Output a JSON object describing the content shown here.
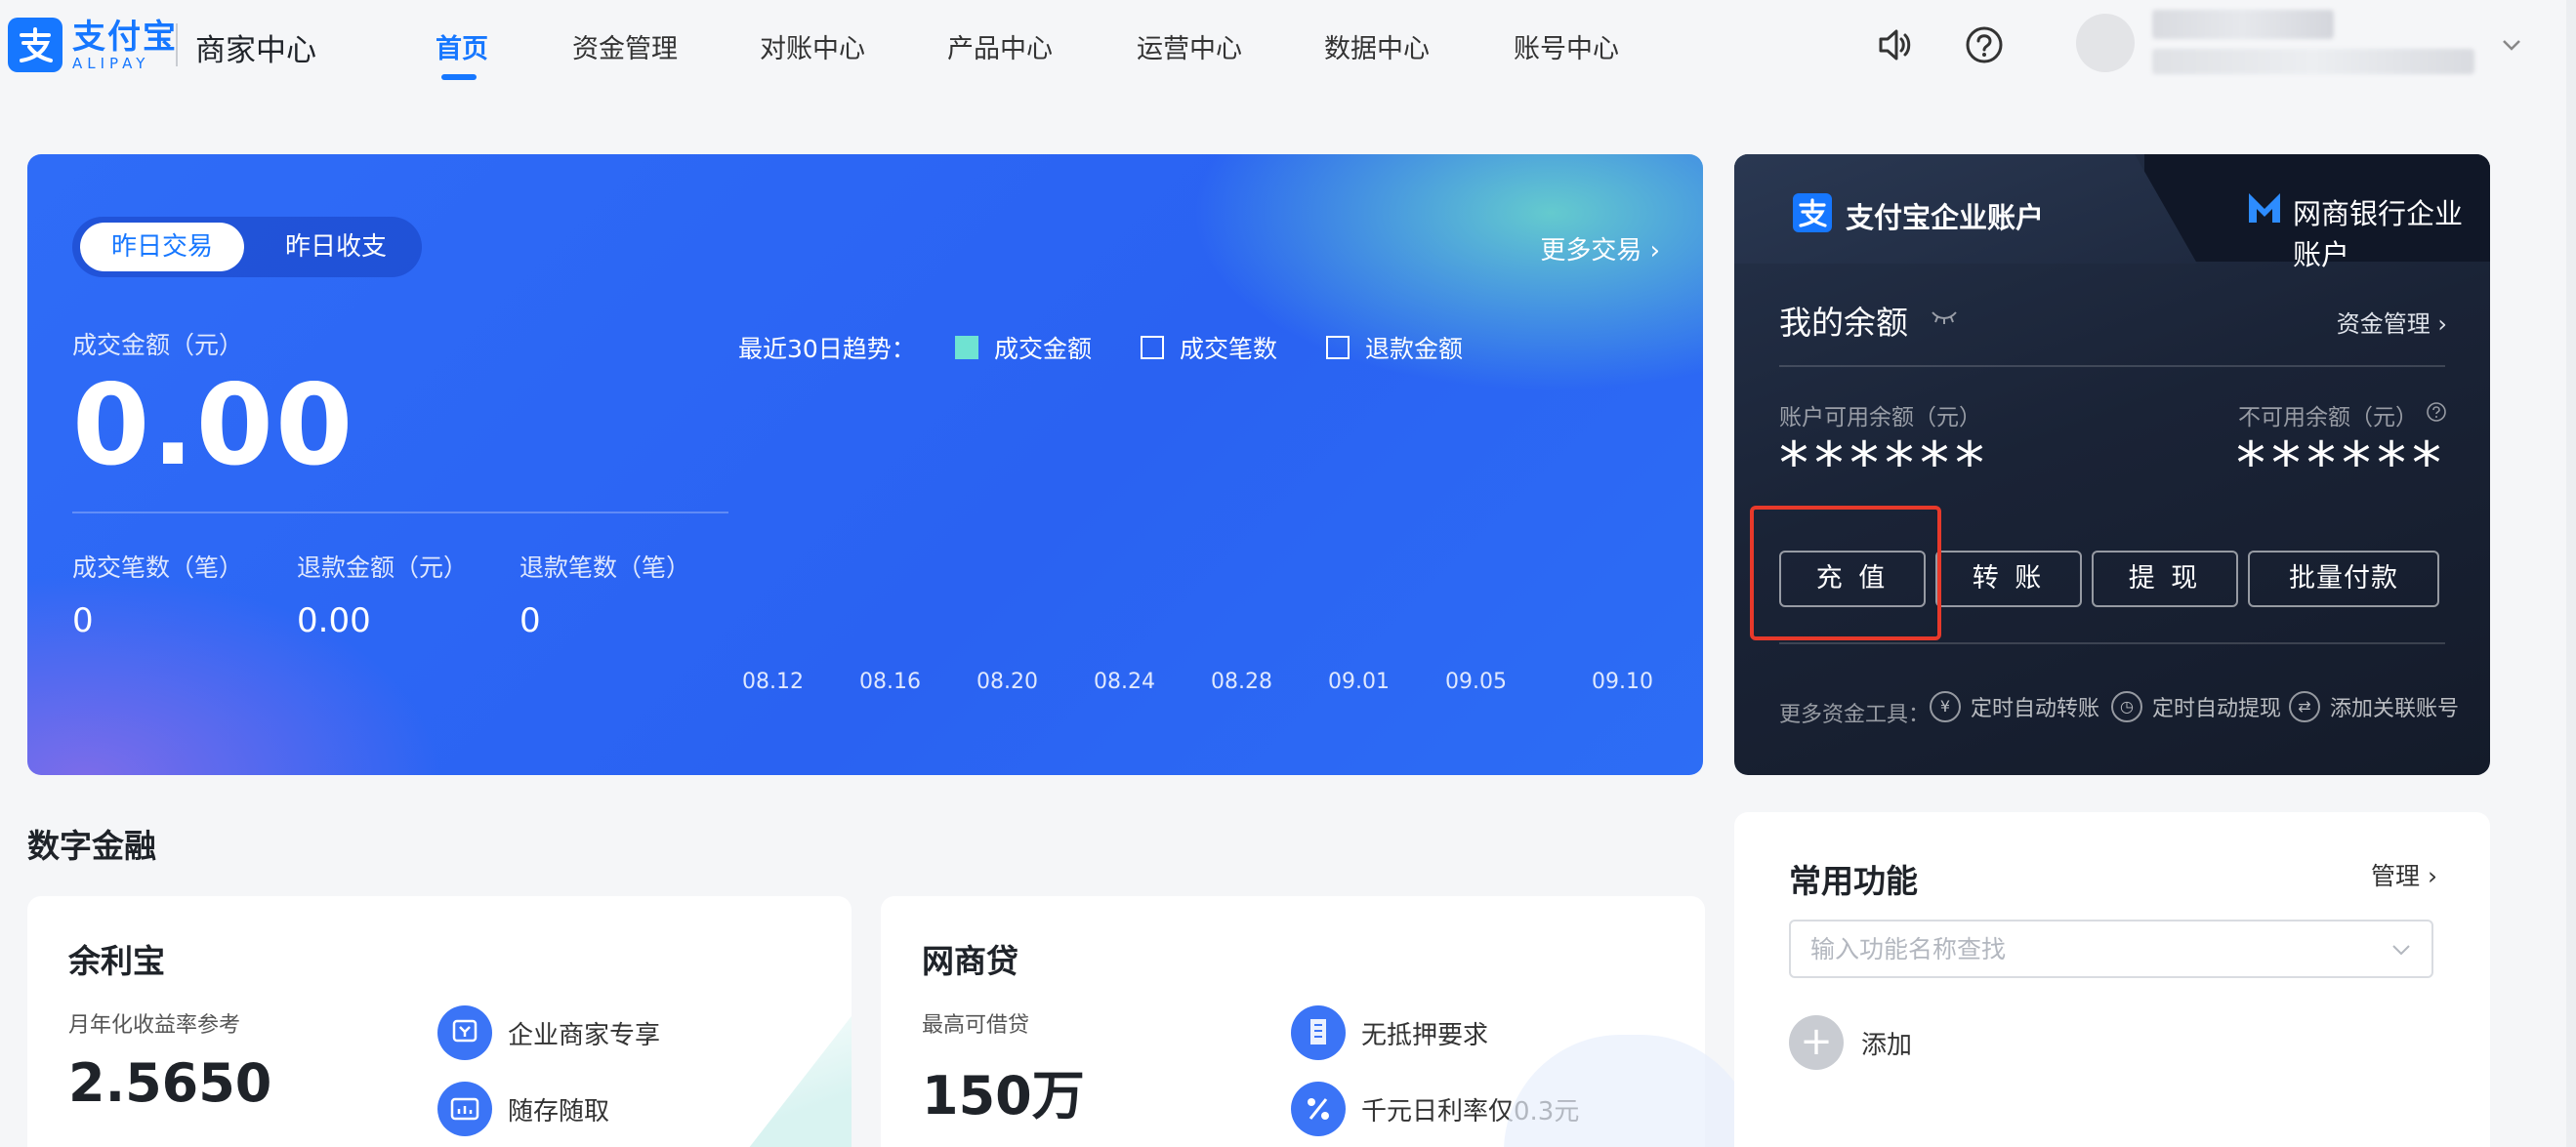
{
  "nav": {
    "brand_cn": "支付宝",
    "brand_en": "ALIPAY",
    "merchant_center": "商家中心",
    "items": [
      "首页",
      "资金管理",
      "对账中心",
      "产品中心",
      "运营中心",
      "数据中心",
      "账号中心"
    ],
    "active_index": 0,
    "icons": [
      "speaker-icon",
      "help-icon"
    ]
  },
  "transactions": {
    "tabs": [
      "昨日交易",
      "昨日收支"
    ],
    "active_tab": 0,
    "more_link": "更多交易",
    "amount_label": "成交金额（元）",
    "amount_value": "0.00",
    "stats": [
      {
        "label": "成交笔数（笔）",
        "value": "0"
      },
      {
        "label": "退款金额（元）",
        "value": "0.00"
      },
      {
        "label": "退款笔数（笔）",
        "value": "0"
      }
    ],
    "trend_label": "最近30日趋势：",
    "legend": [
      {
        "label": "成交金额",
        "checked": true
      },
      {
        "label": "成交笔数",
        "checked": false
      },
      {
        "label": "退款金额",
        "checked": false
      }
    ]
  },
  "chart_data": {
    "type": "line",
    "x": [
      "08.12",
      "08.16",
      "08.20",
      "08.24",
      "08.28",
      "09.01",
      "09.05",
      "09.10"
    ],
    "series": [
      {
        "name": "成交金额",
        "values": [
          0,
          0,
          0,
          0,
          0,
          0,
          0,
          0
        ]
      }
    ],
    "legend_position": "top",
    "colors": {
      "line_start": "#4fd8b0",
      "line_end": "#ffffff"
    }
  },
  "account": {
    "tab_active": "支付宝企业账户",
    "tab_other": "网商银行企业账户",
    "balance_title": "我的余额",
    "fund_mgmt": "资金管理",
    "available_label": "账户可用余额（元）",
    "available_value": "******",
    "unavailable_label": "不可用余额（元）",
    "unavailable_value": "******",
    "actions": [
      "充 值",
      "转 账",
      "提 现",
      "批量付款"
    ],
    "tools_label": "更多资金工具：",
    "tools": [
      {
        "label": "定时自动转账",
        "icon": "yen-circle-icon"
      },
      {
        "label": "定时自动提现",
        "icon": "clock-icon"
      },
      {
        "label": "添加关联账号",
        "icon": "sync-icon"
      }
    ]
  },
  "finance": {
    "section_title": "数字金融",
    "cards": [
      {
        "title": "余利宝",
        "sub": "月年化收益率参考",
        "value": "2.5650",
        "features": [
          "企业商家专享",
          "随存随取"
        ]
      },
      {
        "title": "网商贷",
        "sub": "最高可借贷",
        "value": "150万",
        "features": [
          "无抵押要求",
          "千元日利率仅0.3元"
        ]
      }
    ]
  },
  "common_functions": {
    "title": "常用功能",
    "manage": "管理",
    "search_placeholder": "输入功能名称查找",
    "add_label": "添加"
  },
  "colors": {
    "brand": "#1677ff",
    "highlight": "#e8392a",
    "account_bg": "#1a2336"
  }
}
